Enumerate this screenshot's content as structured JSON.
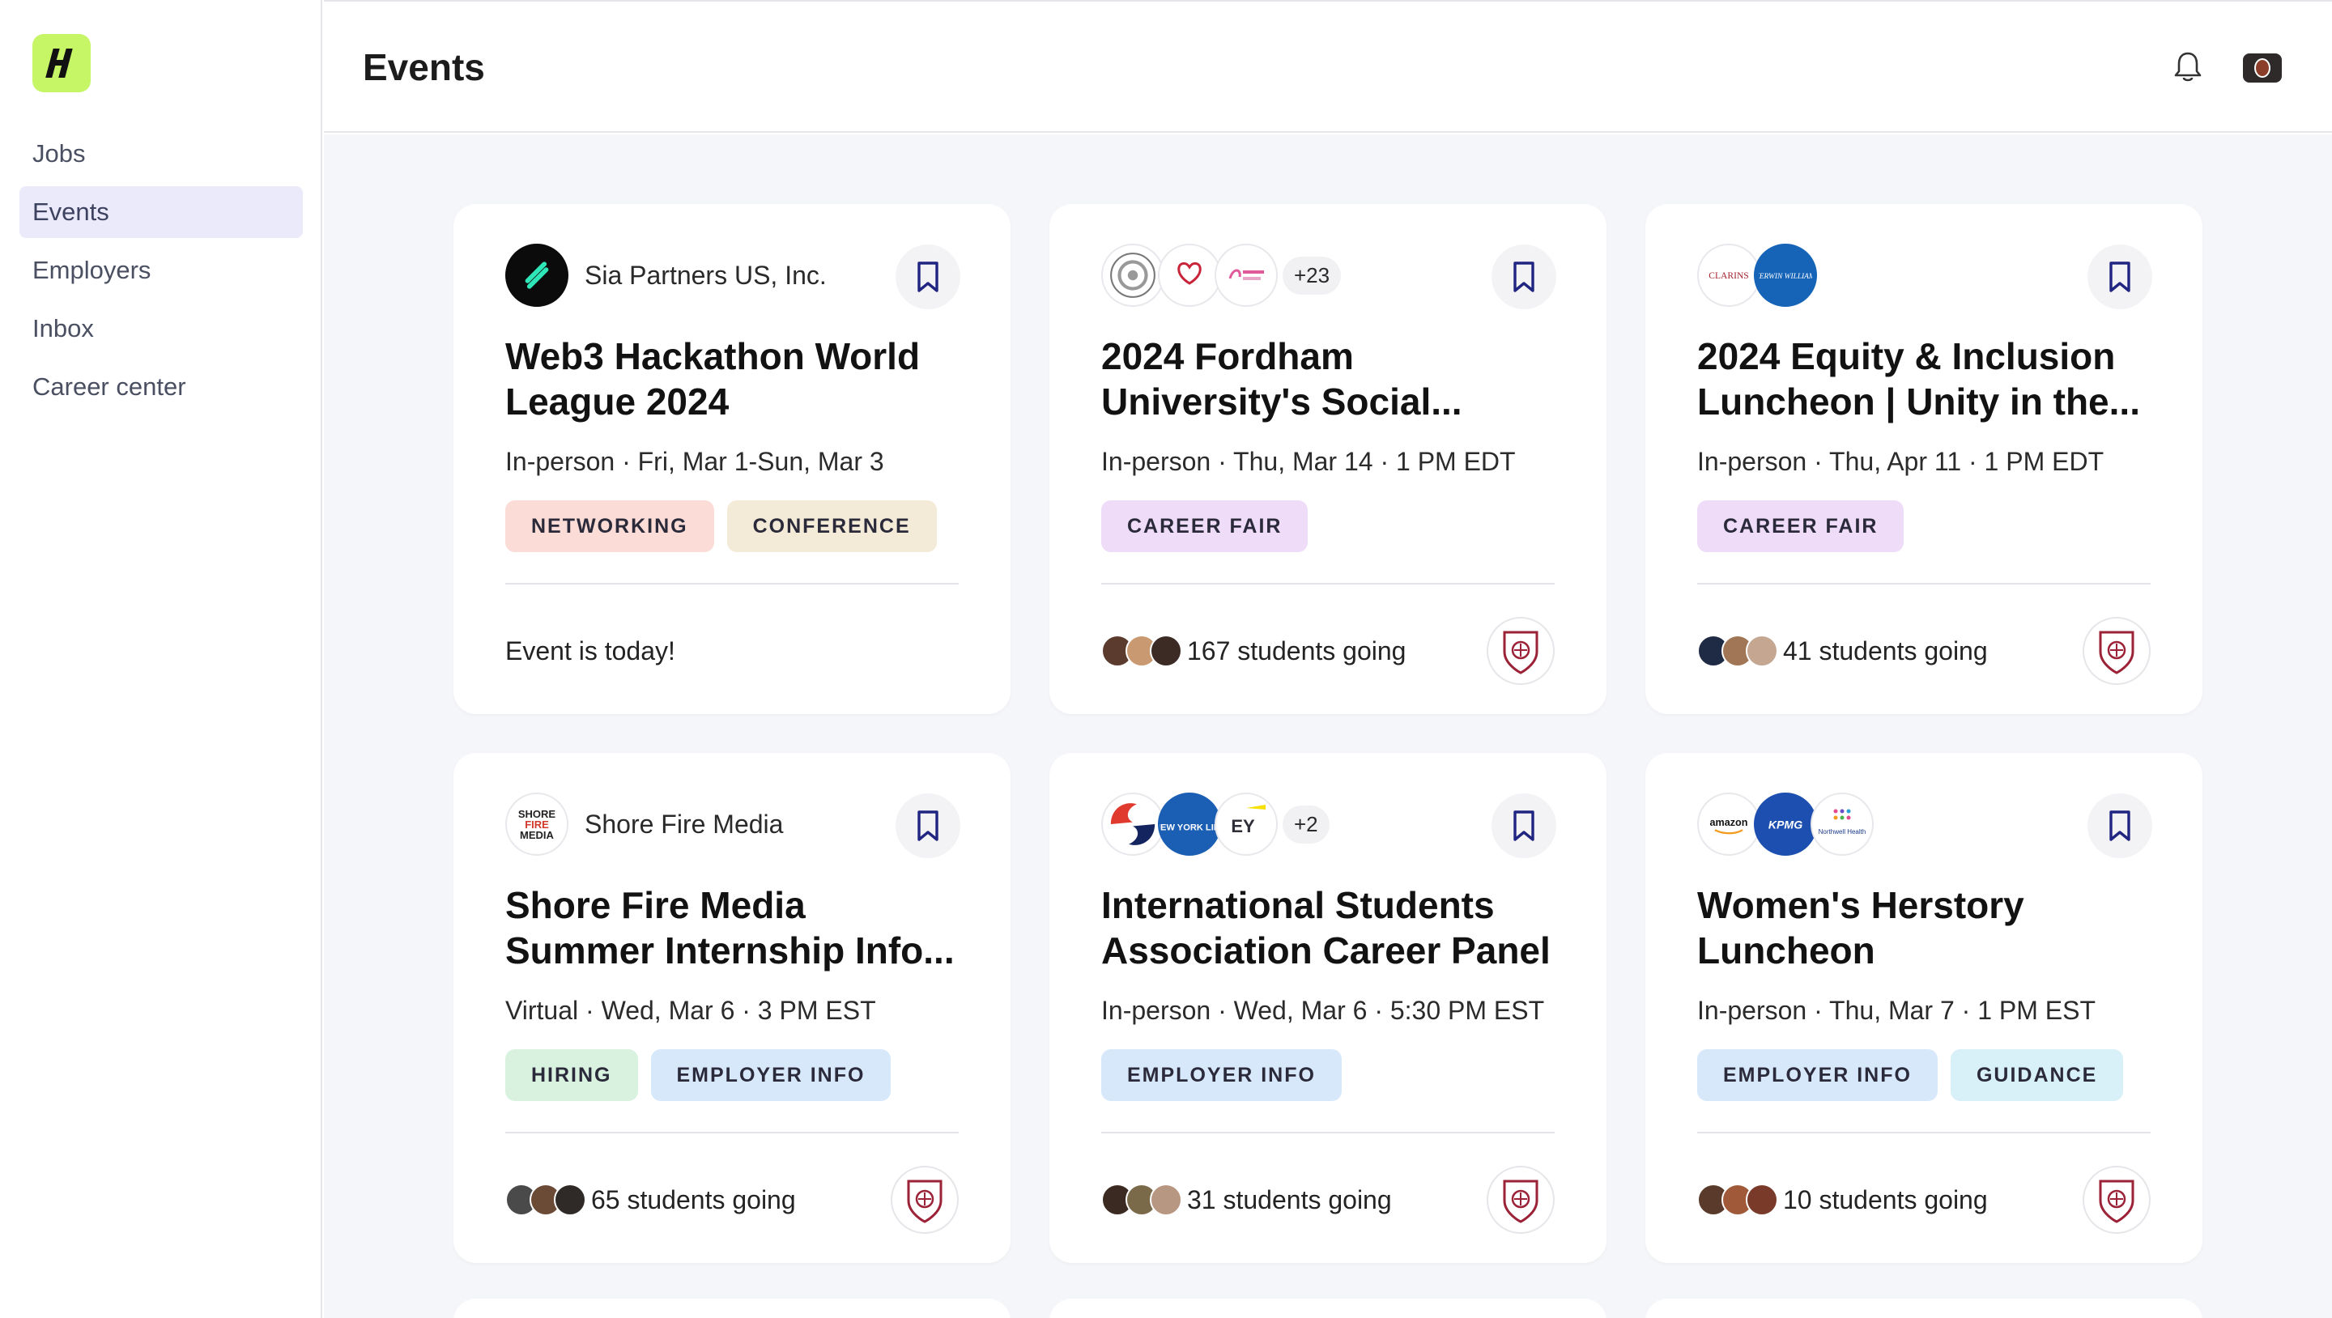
{
  "app": {
    "logo_letter": "H"
  },
  "sidebar": {
    "items": [
      {
        "label": "Jobs"
      },
      {
        "label": "Events"
      },
      {
        "label": "Employers"
      },
      {
        "label": "Inbox"
      },
      {
        "label": "Career center"
      }
    ],
    "active": "Events"
  },
  "header": {
    "title": "Events"
  },
  "colors": {
    "tag_networking": "#fbdcd6",
    "tag_conference": "#f3ead7",
    "tag_career_fair": "#eedcf8",
    "tag_hiring": "#d9f2df",
    "tag_employer_info": "#d8e8fb",
    "tag_guidance": "#d8f0f7",
    "bookmark": "#1f2580",
    "logo_bg": "#c6f566"
  },
  "cards": [
    {
      "org_name": "Sia Partners US, Inc.",
      "title": "Web3 Hackathon World League 2024",
      "meta": "In-person · Fri, Mar 1-Sun, Mar 3",
      "tags": [
        "NETWORKING",
        "CONFERENCE"
      ],
      "footer": "Event is today!"
    },
    {
      "org_plus": "+23",
      "title": "2024 Fordham University's Social...",
      "meta": "In-person · Thu, Mar 14 · 1 PM EDT",
      "tags": [
        "CAREER FAIR"
      ],
      "footer": "167 students going"
    },
    {
      "org_logos": [
        "CLARINS",
        "SHERWIN WILLIAMS."
      ],
      "title": "2024 Equity & Inclusion Luncheon | Unity in the...",
      "meta": "In-person · Thu, Apr 11 · 1 PM EDT",
      "tags": [
        "CAREER FAIR"
      ],
      "footer": "41 students going"
    },
    {
      "org_name": "Shore Fire Media",
      "org_logo_lines": [
        "SHORE",
        "FIRE",
        "MEDIA"
      ],
      "title": "Shore Fire Media Summer Internship Info...",
      "meta": "Virtual · Wed, Mar 6 · 3 PM EST",
      "tags": [
        "HIRING",
        "EMPLOYER INFO"
      ],
      "footer": "65 students going"
    },
    {
      "org_plus": "+2",
      "org_logos": [
        "NEW YORK LIFE",
        "EY"
      ],
      "title": "International Students Association Career Panel",
      "meta": "In-person · Wed, Mar 6 · 5:30 PM EST",
      "tags": [
        "EMPLOYER INFO"
      ],
      "footer": "31 students going"
    },
    {
      "org_logos": [
        "amazon",
        "KPMG",
        "Northwell Health"
      ],
      "title": "Women's Herstory Luncheon",
      "meta": "In-person · Thu, Mar 7 · 1 PM EST",
      "tags": [
        "EMPLOYER INFO",
        "GUIDANCE"
      ],
      "footer": "10 students going"
    }
  ]
}
